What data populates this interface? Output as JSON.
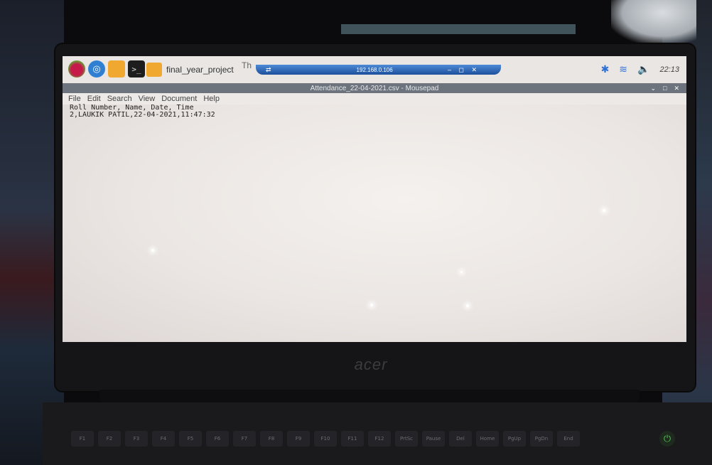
{
  "taskbar": {
    "launcher_icons": [
      "raspberry-pi-menu-icon",
      "web-browser-icon",
      "file-manager-icon",
      "terminal-icon"
    ],
    "tasks": [
      "final_year_project",
      "Th"
    ],
    "remote_session": {
      "address": "192.168.0.106"
    },
    "tray": {
      "clock": "22:13"
    }
  },
  "window": {
    "title": "Attendance_22-04-2021.csv - Mousepad",
    "menu": [
      "File",
      "Edit",
      "Search",
      "View",
      "Document",
      "Help"
    ]
  },
  "document": {
    "lines": [
      "Roll Number, Name, Date, Time",
      "2,LAUKIK PATIL,22-04-2021,11:47:32"
    ]
  },
  "laptop": {
    "brand": "acer",
    "keys": [
      "F1",
      "F2",
      "F3",
      "F4",
      "F5",
      "F6",
      "F7",
      "F8",
      "F9",
      "F10",
      "F11",
      "F12",
      "PrtSc",
      "Pause",
      "Del",
      "Home",
      "PgUp",
      "PgDn",
      "End"
    ]
  },
  "colors": {
    "titlebar": "#6c737c",
    "remote_bar": "#1b4f9c",
    "folder": "#f0a830",
    "tray_icons": "#2d6fd8"
  }
}
